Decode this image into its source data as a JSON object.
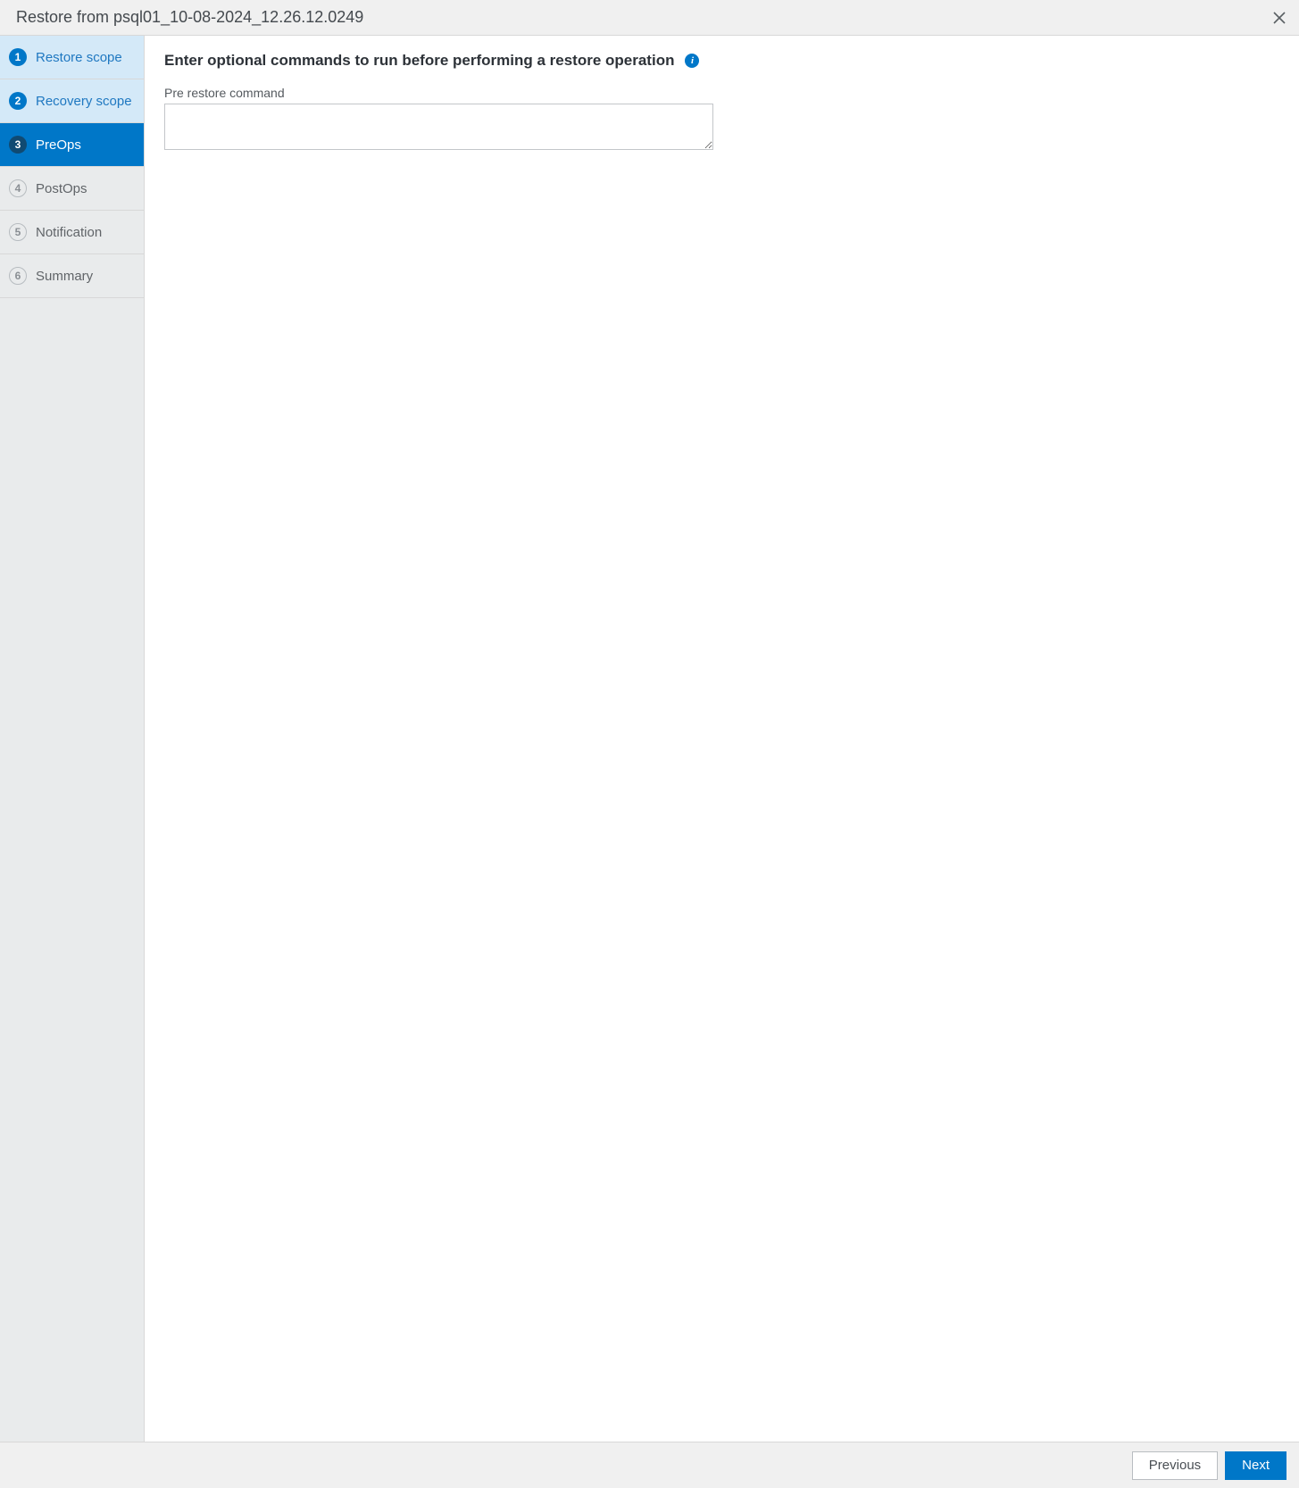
{
  "header": {
    "title": "Restore from psql01_10-08-2024_12.26.12.0249"
  },
  "sidebar": {
    "steps": [
      {
        "num": "1",
        "label": "Restore scope"
      },
      {
        "num": "2",
        "label": "Recovery scope"
      },
      {
        "num": "3",
        "label": "PreOps"
      },
      {
        "num": "4",
        "label": "PostOps"
      },
      {
        "num": "5",
        "label": "Notification"
      },
      {
        "num": "6",
        "label": "Summary"
      }
    ]
  },
  "main": {
    "heading": "Enter optional commands to run before performing a restore operation",
    "field_label": "Pre restore command",
    "command_value": ""
  },
  "footer": {
    "previous": "Previous",
    "next": "Next"
  },
  "icons": {
    "info_glyph": "i"
  }
}
